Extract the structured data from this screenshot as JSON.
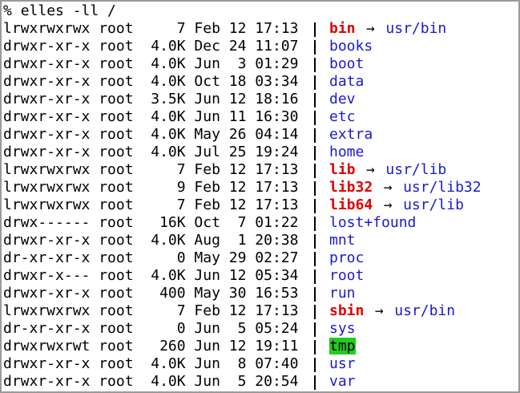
{
  "prompt": {
    "symbol": "%",
    "command": "elles -ll /"
  },
  "colors": {
    "directory": "#1a1ad0",
    "symlink": "#e00000",
    "sticky_bg": "#22cc22"
  },
  "arrow_glyph": "→",
  "entries": [
    {
      "perms": "lrwxrwxrwx",
      "owner": "root",
      "size": "7",
      "month": "Feb",
      "day": "12",
      "time": "17:13",
      "name": "bin",
      "type": "link",
      "target": "usr/bin"
    },
    {
      "perms": "drwxr-xr-x",
      "owner": "root",
      "size": "4.0K",
      "month": "Dec",
      "day": "24",
      "time": "11:07",
      "name": "books",
      "type": "dir",
      "target": ""
    },
    {
      "perms": "drwxr-xr-x",
      "owner": "root",
      "size": "4.0K",
      "month": "Jun",
      "day": "3",
      "time": "01:29",
      "name": "boot",
      "type": "dir",
      "target": ""
    },
    {
      "perms": "drwxr-xr-x",
      "owner": "root",
      "size": "4.0K",
      "month": "Oct",
      "day": "18",
      "time": "03:34",
      "name": "data",
      "type": "dir",
      "target": ""
    },
    {
      "perms": "drwxr-xr-x",
      "owner": "root",
      "size": "3.5K",
      "month": "Jun",
      "day": "12",
      "time": "18:16",
      "name": "dev",
      "type": "dir",
      "target": ""
    },
    {
      "perms": "drwxr-xr-x",
      "owner": "root",
      "size": "4.0K",
      "month": "Jun",
      "day": "11",
      "time": "16:30",
      "name": "etc",
      "type": "dir",
      "target": ""
    },
    {
      "perms": "drwxr-xr-x",
      "owner": "root",
      "size": "4.0K",
      "month": "May",
      "day": "26",
      "time": "04:14",
      "name": "extra",
      "type": "dir",
      "target": ""
    },
    {
      "perms": "drwxr-xr-x",
      "owner": "root",
      "size": "4.0K",
      "month": "Jul",
      "day": "25",
      "time": "19:24",
      "name": "home",
      "type": "dir",
      "target": ""
    },
    {
      "perms": "lrwxrwxrwx",
      "owner": "root",
      "size": "7",
      "month": "Feb",
      "day": "12",
      "time": "17:13",
      "name": "lib",
      "type": "link",
      "target": "usr/lib"
    },
    {
      "perms": "lrwxrwxrwx",
      "owner": "root",
      "size": "9",
      "month": "Feb",
      "day": "12",
      "time": "17:13",
      "name": "lib32",
      "type": "link",
      "target": "usr/lib32"
    },
    {
      "perms": "lrwxrwxrwx",
      "owner": "root",
      "size": "7",
      "month": "Feb",
      "day": "12",
      "time": "17:13",
      "name": "lib64",
      "type": "link",
      "target": "usr/lib"
    },
    {
      "perms": "drwx------",
      "owner": "root",
      "size": "16K",
      "month": "Oct",
      "day": "7",
      "time": "01:22",
      "name": "lost+found",
      "type": "dir",
      "target": ""
    },
    {
      "perms": "drwxr-xr-x",
      "owner": "root",
      "size": "4.0K",
      "month": "Aug",
      "day": "1",
      "time": "20:38",
      "name": "mnt",
      "type": "dir",
      "target": ""
    },
    {
      "perms": "dr-xr-xr-x",
      "owner": "root",
      "size": "0",
      "month": "May",
      "day": "29",
      "time": "02:27",
      "name": "proc",
      "type": "dir",
      "target": ""
    },
    {
      "perms": "drwxr-x---",
      "owner": "root",
      "size": "4.0K",
      "month": "Jun",
      "day": "12",
      "time": "05:34",
      "name": "root",
      "type": "dir",
      "target": ""
    },
    {
      "perms": "drwxr-xr-x",
      "owner": "root",
      "size": "400",
      "month": "May",
      "day": "30",
      "time": "16:53",
      "name": "run",
      "type": "dir",
      "target": ""
    },
    {
      "perms": "lrwxrwxrwx",
      "owner": "root",
      "size": "7",
      "month": "Feb",
      "day": "12",
      "time": "17:13",
      "name": "sbin",
      "type": "link",
      "target": "usr/bin"
    },
    {
      "perms": "dr-xr-xr-x",
      "owner": "root",
      "size": "0",
      "month": "Jun",
      "day": "5",
      "time": "05:24",
      "name": "sys",
      "type": "dir",
      "target": ""
    },
    {
      "perms": "drwxrwxrwt",
      "owner": "root",
      "size": "260",
      "month": "Jun",
      "day": "12",
      "time": "19:11",
      "name": "tmp",
      "type": "sticky",
      "target": ""
    },
    {
      "perms": "drwxr-xr-x",
      "owner": "root",
      "size": "4.0K",
      "month": "Jun",
      "day": "8",
      "time": "07:40",
      "name": "usr",
      "type": "dir",
      "target": ""
    },
    {
      "perms": "drwxr-xr-x",
      "owner": "root",
      "size": "4.0K",
      "month": "Jun",
      "day": "5",
      "time": "20:54",
      "name": "var",
      "type": "dir",
      "target": ""
    }
  ]
}
